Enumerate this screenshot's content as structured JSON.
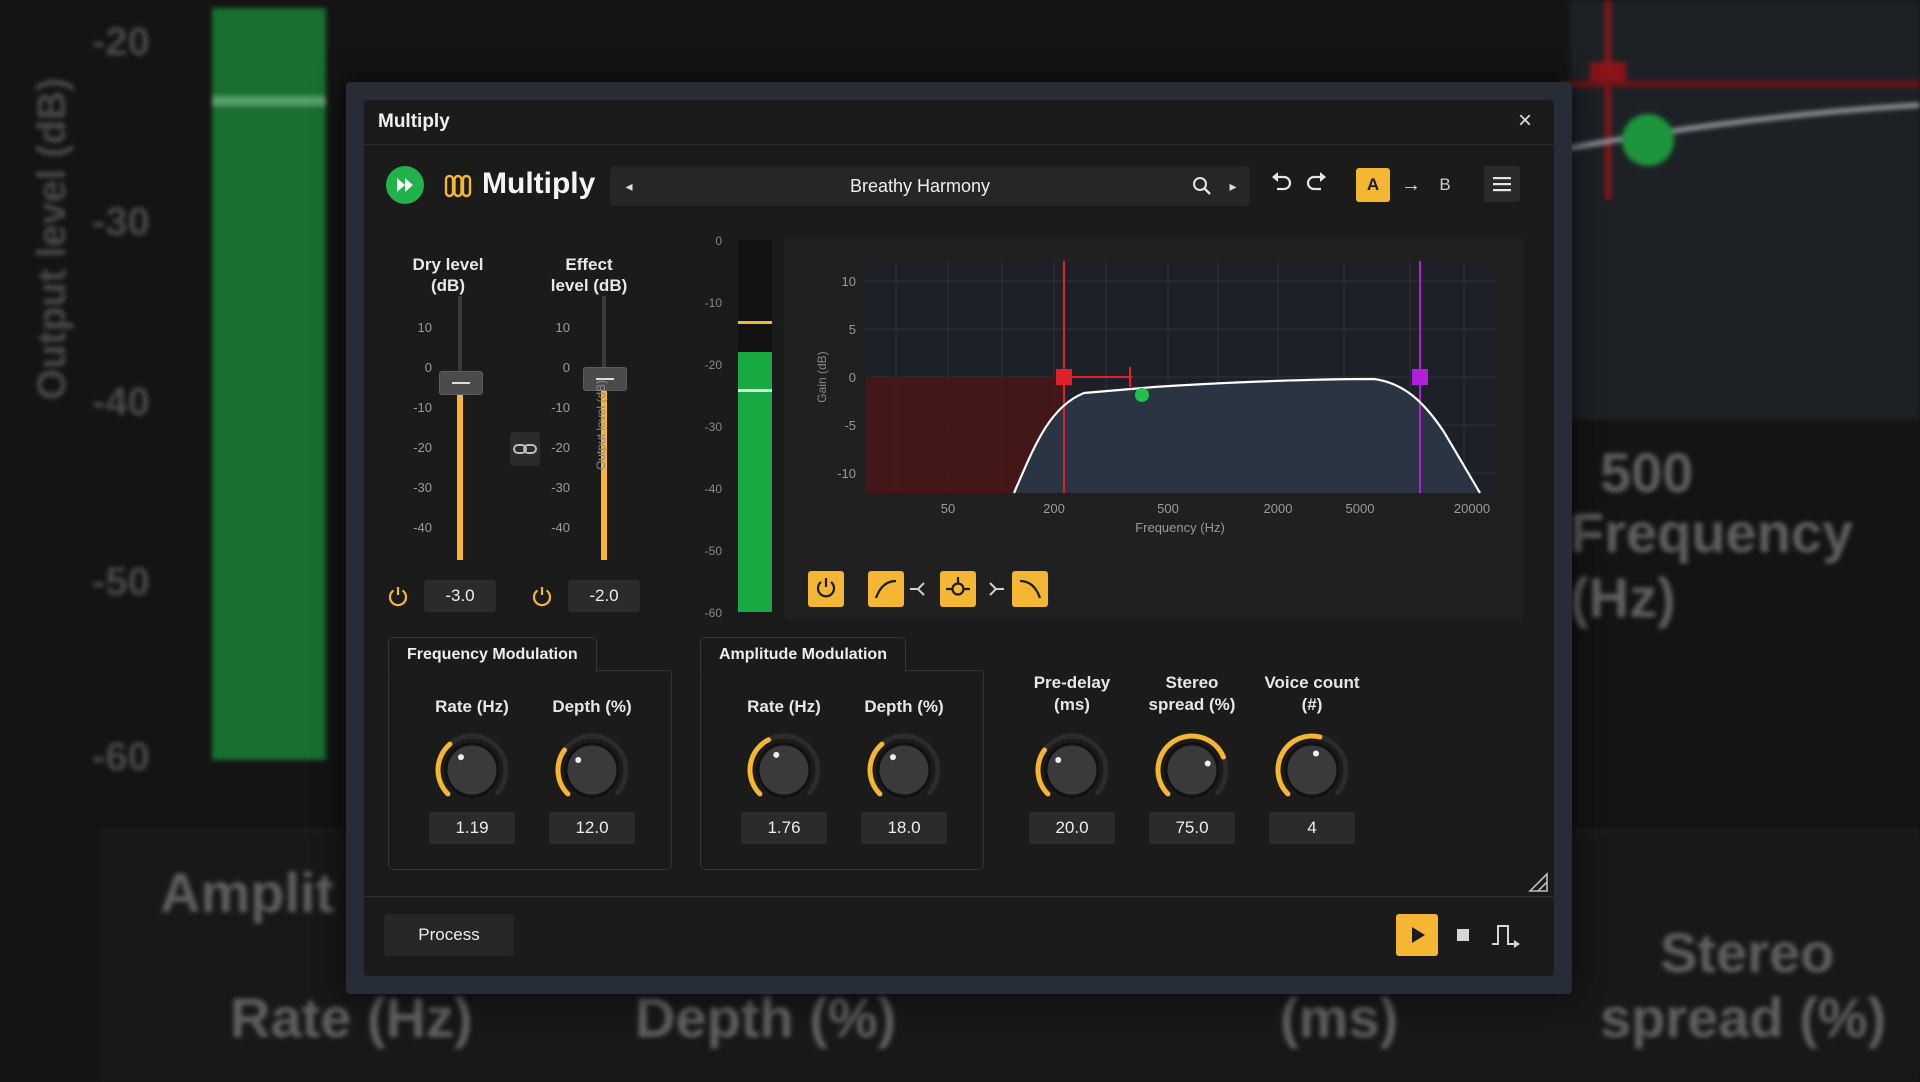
{
  "background": {
    "meter_ticks": [
      "-20",
      "-30",
      "-40",
      "-50",
      "-60"
    ],
    "meter_label": "Output level (dB)",
    "freq_tick": "500",
    "freq_label": "Frequency (Hz)",
    "amp_label": "Amplit",
    "rate_label": "Rate (Hz)",
    "depth_label": "Depth (%)",
    "ms_label": "(ms)",
    "stereo_label_1": "Stereo",
    "stereo_label_2": "spread (%)"
  },
  "window": {
    "title": "Multiply"
  },
  "header": {
    "plugin_name": "Multiply",
    "preset_name": "Breathy Harmony",
    "ab_a": "A",
    "ab_b": "B"
  },
  "faders": {
    "dry": {
      "title_line1": "Dry level",
      "title_line2": "(dB)",
      "value": "-3.0",
      "level_db": -3.0
    },
    "effect": {
      "title_line1": "Effect",
      "title_line2": "level (dB)",
      "value": "-2.0",
      "level_db": -2.0
    },
    "ticks": [
      "10",
      "0",
      "-10",
      "-20",
      "-30",
      "-40"
    ]
  },
  "meter": {
    "label": "Output level (dB)",
    "ticks": [
      "0",
      "-10",
      "-20",
      "-30",
      "-40",
      "-50",
      "-60"
    ],
    "level_db": -18,
    "peak_db": -24,
    "hold_db": -13
  },
  "eq": {
    "y_ticks": [
      "10",
      "5",
      "0",
      "-5",
      "-10"
    ],
    "x_ticks": [
      "50",
      "200",
      "500",
      "2000",
      "5000",
      "20000"
    ],
    "x_label": "Frequency (Hz)",
    "y_label": "Gain (dB)",
    "colors": {
      "low_cut": "#e0202a",
      "high_cut": "#b020d8",
      "bell": "#21c04a",
      "curve": "#ffffff"
    }
  },
  "freq_mod": {
    "title": "Frequency Modulation",
    "rate_label": "Rate (Hz)",
    "rate_value": "1.19",
    "rate_pos": 0.35,
    "depth_label": "Depth (%)",
    "depth_value": "12.0",
    "depth_pos": 0.3
  },
  "amp_mod": {
    "title": "Amplitude Modulation",
    "rate_label": "Rate (Hz)",
    "rate_value": "1.76",
    "rate_pos": 0.4,
    "depth_label": "Depth (%)",
    "depth_value": "18.0",
    "depth_pos": 0.35
  },
  "voices": {
    "predelay_label_1": "Pre-delay",
    "predelay_label_2": "(ms)",
    "predelay_value": "20.0",
    "predelay_pos": 0.3,
    "stereo_label_1": "Stereo",
    "stereo_label_2": "spread (%)",
    "stereo_value": "75.0",
    "stereo_pos": 0.75,
    "voice_label_1": "Voice count",
    "voice_label_2": "(#)",
    "voice_value": "4",
    "voice_pos": 0.55
  },
  "footer": {
    "process_label": "Process"
  },
  "accent_color": "#f4b633"
}
